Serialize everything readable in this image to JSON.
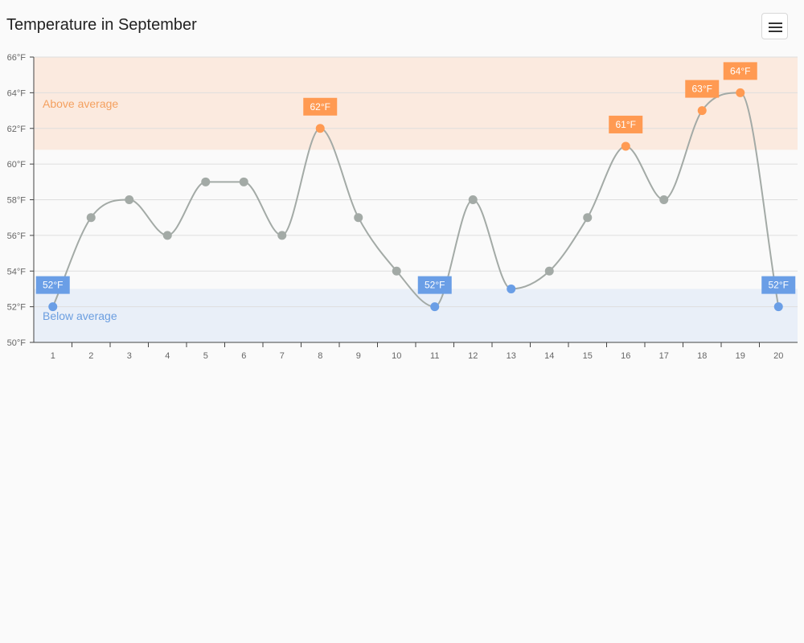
{
  "chart_data": {
    "type": "line",
    "title": "Temperature in September",
    "categories": [
      "1",
      "2",
      "3",
      "4",
      "5",
      "6",
      "7",
      "8",
      "9",
      "10",
      "11",
      "12",
      "13",
      "14",
      "15",
      "16",
      "17",
      "18",
      "19",
      "20"
    ],
    "series": [
      {
        "values": [
          52,
          57,
          58,
          56,
          59,
          59,
          56,
          62,
          57,
          54,
          52,
          58,
          53,
          54,
          57,
          61,
          58,
          63,
          64,
          52
        ]
      }
    ],
    "ylim": [
      50,
      66
    ],
    "yticks": [
      50,
      52,
      54,
      56,
      58,
      60,
      62,
      64,
      66
    ],
    "y_unit": "°F",
    "grid": true,
    "bands": [
      {
        "label": "Above average",
        "from": 60.8,
        "to": 66,
        "color": "#fbeadf",
        "text_color": "#f4a05f"
      },
      {
        "label": "Below average",
        "from": 50,
        "to": 53,
        "color": "#e9eff8",
        "text_color": "#6b9ee0"
      }
    ],
    "data_labels": [
      {
        "index": 0,
        "text": "52°F",
        "style": "below"
      },
      {
        "index": 7,
        "text": "62°F",
        "style": "above"
      },
      {
        "index": 10,
        "text": "52°F",
        "style": "below"
      },
      {
        "index": 15,
        "text": "61°F",
        "style": "above"
      },
      {
        "index": 17,
        "text": "63°F",
        "style": "above"
      },
      {
        "index": 18,
        "text": "64°F",
        "style": "above"
      },
      {
        "index": 19,
        "text": "52°F",
        "style": "below"
      }
    ],
    "colors": {
      "line": "#a3aaa6",
      "normal": "#a3aaa6",
      "above": "#ff9a52",
      "below": "#6a9ee6"
    }
  },
  "toolbar": {
    "menu_icon": "hamburger-menu-icon"
  }
}
